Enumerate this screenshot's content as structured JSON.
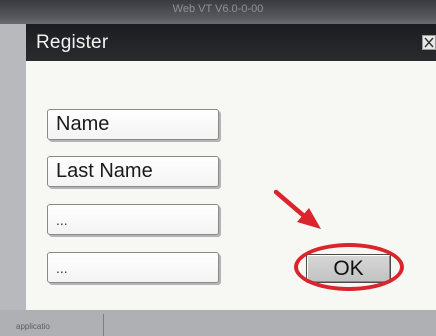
{
  "window": {
    "title": "Web VT V6.0-0-00"
  },
  "dialog": {
    "title": "Register",
    "close_icon": "close-icon"
  },
  "fields": [
    {
      "value": "Name"
    },
    {
      "value": "Last Name"
    },
    {
      "value": "..."
    },
    {
      "value": "..."
    }
  ],
  "ok_button": {
    "label": "OK"
  },
  "annotation": {
    "highlight_color": "#d9252b"
  },
  "statusbar": {
    "label": "applicatio"
  }
}
